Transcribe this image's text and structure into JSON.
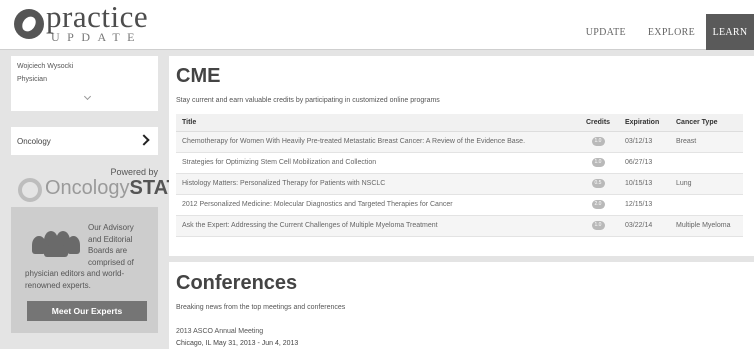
{
  "header": {
    "logo_word": "practice",
    "logo_sub": "UPDATE",
    "nav": [
      {
        "label": "UPDATE",
        "active": false
      },
      {
        "label": "EXPLORE",
        "active": false
      },
      {
        "label": "LEARN",
        "active": true
      }
    ]
  },
  "sidebar": {
    "user_name": "Wojciech Wysocki",
    "user_role": "Physician",
    "specialty": "Oncology",
    "powered_by": "Powered by",
    "partner_light": "Oncology",
    "partner_bold": "STAT",
    "advisory_lines": [
      "Our Advisory",
      "and Editorial",
      "Boards are",
      "comprised of"
    ],
    "advisory_rest": [
      "physician editors and world-",
      "renowned experts."
    ],
    "experts_button": "Meet Our Experts"
  },
  "cme": {
    "title": "CME",
    "description": "Stay current and earn valuable credits by participating in customized online programs",
    "columns": [
      "Title",
      "Credits",
      "Expiration",
      "Cancer Type"
    ],
    "rows": [
      {
        "title": "Chemotherapy for Women With Heavily Pre-treated Metastatic Breast Cancer: A Review of the Evidence Base.",
        "credits": "1.0",
        "expiration": "03/12/13",
        "type": "Breast"
      },
      {
        "title": "Strategies for Optimizing Stem Cell Mobilization and Collection",
        "credits": "1.0",
        "expiration": "06/27/13",
        "type": ""
      },
      {
        "title": "Histology Matters: Personalized Therapy for Patients with NSCLC",
        "credits": "0.5",
        "expiration": "10/15/13",
        "type": "Lung"
      },
      {
        "title": "2012 Personalized Medicine: Molecular Diagnostics and Targeted Therapies for Cancer",
        "credits": "2.0",
        "expiration": "12/15/13",
        "type": ""
      },
      {
        "title": "Ask the Expert: Addressing the Current Challenges of Multiple Myeloma Treatment",
        "credits": "1.0",
        "expiration": "03/22/14",
        "type": "Multiple Myeloma"
      }
    ]
  },
  "conferences": {
    "title": "Conferences",
    "description": "Breaking news from the top meetings and conferences",
    "item_name": "2013 ASCO Annual Meeting",
    "item_location": "Chicago, IL   May 31, 2013 - Jun 4, 2013"
  }
}
